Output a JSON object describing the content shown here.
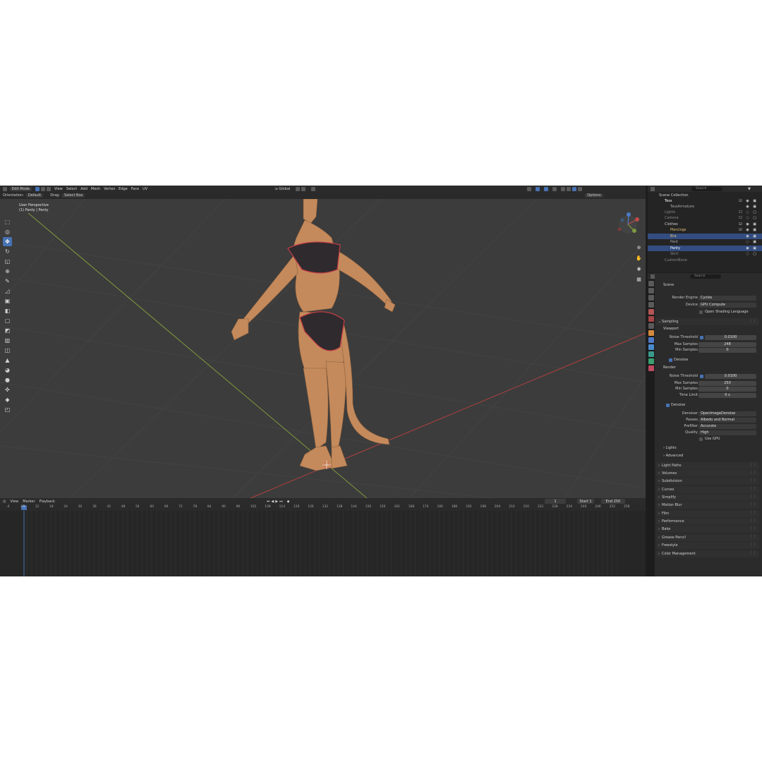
{
  "viewport": {
    "header": {
      "mode": "Edit Mode",
      "menus": [
        "View",
        "Select",
        "Add",
        "Mesh",
        "Vertex",
        "Edge",
        "Face",
        "UV"
      ],
      "transform": "Global"
    },
    "tool_header": {
      "orientation_label": "Orientation:",
      "orientation": "Default",
      "drag_label": "Drag:",
      "drag": "Select Box",
      "options": "Options"
    },
    "overlay": {
      "perspective": "User Perspective",
      "object": "(1) Panty | Panty"
    },
    "colors": {
      "accent": "#4772b3",
      "background": "#3c3c3c",
      "skin": "#c48a5c",
      "x_axis": "#b2403f",
      "y_axis": "#7f9a3c"
    }
  },
  "timeline": {
    "menus": [
      "View",
      "Marker",
      "Playback"
    ],
    "current_frame": "1",
    "start_label": "Start",
    "start": "1",
    "end_label": "End",
    "end": "250",
    "ruler": [
      "-4",
      "4",
      "12",
      "18",
      "24",
      "30",
      "36",
      "42",
      "48",
      "54",
      "60",
      "66",
      "72",
      "78",
      "84",
      "90",
      "96",
      "102",
      "108",
      "114",
      "120",
      "126",
      "132",
      "138",
      "144",
      "150",
      "156",
      "162",
      "168",
      "174",
      "180",
      "186",
      "192",
      "198",
      "204",
      "210",
      "216",
      "222",
      "228",
      "234",
      "240",
      "246",
      "252",
      "258"
    ],
    "playhead": "1"
  },
  "outliner": {
    "search_placeholder": "Search",
    "items": [
      {
        "label": "Scene Collection"
      },
      {
        "label": "Tess"
      },
      {
        "label": "TessArmature"
      },
      {
        "label": "Lights"
      },
      {
        "label": "Camera"
      },
      {
        "label": "Clothes"
      },
      {
        "label": "Piercings"
      },
      {
        "label": "Bra"
      },
      {
        "label": "Pant"
      },
      {
        "label": "Panty"
      },
      {
        "label": "Skirt"
      },
      {
        "label": "CustomBone"
      }
    ]
  },
  "properties": {
    "search_placeholder": "Search",
    "breadcrumb": "Scene",
    "render_engine_label": "Render Engine",
    "render_engine": "Cycles",
    "device_label": "Device",
    "device": "GPU Compute",
    "osl_label": "Open Shading Language",
    "sampling": "Sampling",
    "viewport_sub": "Viewport",
    "noise_threshold_label": "Noise Threshold",
    "vp_noise": "0.0100",
    "max_samples_label": "Max Samples",
    "vp_max": "248",
    "min_samples_label": "Min Samples",
    "vp_min": "0",
    "denoise_label": "Denoise",
    "render_sub": "Render",
    "r_noise": "0.0100",
    "r_max": "250",
    "r_min": "0",
    "time_limit_label": "Time Limit",
    "r_time": "0 s",
    "denoiser_label": "Denoiser",
    "denoiser": "OpenImageDenoise",
    "passes_label": "Passes",
    "passes": "Albedo and Normal",
    "prefilter_label": "Prefilter",
    "prefilter": "Accurate",
    "quality_label": "Quality",
    "quality": "High",
    "use_gpu_label": "Use GPU",
    "lights": "Lights",
    "advanced": "Advanced",
    "panels": [
      "Light Paths",
      "Volumes",
      "Subdivision",
      "Curves",
      "Simplify",
      "Motion Blur",
      "Film",
      "Performance",
      "Bake",
      "Grease Pencil",
      "Freestyle",
      "Color Management"
    ]
  }
}
